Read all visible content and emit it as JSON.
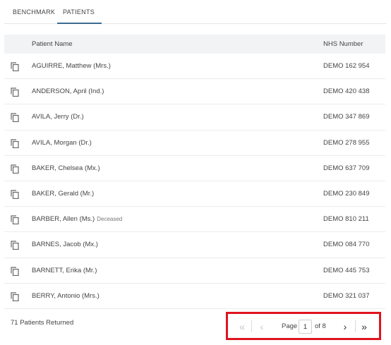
{
  "tabs": [
    {
      "label": "BENCHMARK"
    },
    {
      "label": "PATIENTS"
    }
  ],
  "table": {
    "headers": {
      "name": "Patient Name",
      "nhs": "NHS Number"
    },
    "rows": [
      {
        "name": "AGUIRRE, Matthew (Mrs.)",
        "status": "",
        "nhs": "DEMO 162 954"
      },
      {
        "name": "ANDERSON, April (Ind.)",
        "status": "",
        "nhs": "DEMO 420 438"
      },
      {
        "name": "AVILA, Jerry (Dr.)",
        "status": "",
        "nhs": "DEMO 347 869"
      },
      {
        "name": "AVILA, Morgan (Dr.)",
        "status": "",
        "nhs": "DEMO 278 955"
      },
      {
        "name": "BAKER, Chelsea (Mx.)",
        "status": "",
        "nhs": "DEMO 637 709"
      },
      {
        "name": "BAKER, Gerald (Mr.)",
        "status": "",
        "nhs": "DEMO 230 849"
      },
      {
        "name": "BARBER, Allen (Ms.)",
        "status": "Deceased",
        "nhs": "DEMO 810 211"
      },
      {
        "name": "BARNES, Jacob (Mx.)",
        "status": "",
        "nhs": "DEMO 084 770"
      },
      {
        "name": "BARNETT, Erika (Mr.)",
        "status": "",
        "nhs": "DEMO 445 753"
      },
      {
        "name": "BERRY, Antonio (Mrs.)",
        "status": "",
        "nhs": "DEMO 321 037"
      }
    ]
  },
  "footer": {
    "count_text": "71 Patients Returned"
  },
  "pagination": {
    "page_label": "Page",
    "current_page": "1",
    "of_text": "of 8",
    "first_icon": "double-chevron-left-icon",
    "prev_icon": "chevron-left-icon",
    "next_icon": "chevron-right-icon",
    "last_icon": "double-chevron-right-icon"
  },
  "colors": {
    "tab_underline": "#3d6b8f",
    "highlight_box": "#e0131f",
    "header_bg": "#f2f3f5"
  }
}
